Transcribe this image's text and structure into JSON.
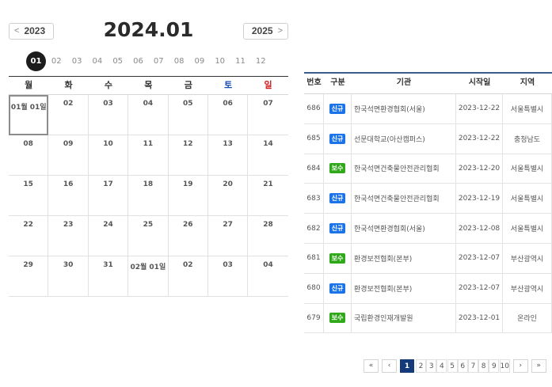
{
  "calendar": {
    "prev_year": "2023",
    "next_year": "2025",
    "title": "2024.01",
    "months": [
      "01",
      "02",
      "03",
      "04",
      "05",
      "06",
      "07",
      "08",
      "09",
      "10",
      "11",
      "12"
    ],
    "active_month_index": 0,
    "weekdays": [
      "월",
      "화",
      "수",
      "목",
      "금",
      "토",
      "일"
    ],
    "days": [
      "01월 01일",
      "02",
      "03",
      "04",
      "05",
      "06",
      "07",
      "08",
      "09",
      "10",
      "11",
      "12",
      "13",
      "14",
      "15",
      "16",
      "17",
      "18",
      "19",
      "20",
      "21",
      "22",
      "23",
      "24",
      "25",
      "26",
      "27",
      "28",
      "29",
      "30",
      "31",
      "02월 01일",
      "02",
      "03",
      "04"
    ],
    "colors": {
      "saturday": "#1b4fb5",
      "sunday": "#d0191c",
      "active_month_bg": "#1d1d1d"
    }
  },
  "table": {
    "headers": [
      "번호",
      "구분",
      "기관",
      "시작일",
      "지역"
    ],
    "rows": [
      {
        "no": "686",
        "type": "신규",
        "type_kind": "new",
        "org": "한국석면환경협회(서울)",
        "date": "2023-12-22",
        "region": "서울특별시"
      },
      {
        "no": "685",
        "type": "신규",
        "type_kind": "new",
        "org": "선문대학교(아산캠퍼스)",
        "date": "2023-12-22",
        "region": "충청남도"
      },
      {
        "no": "684",
        "type": "보수",
        "type_kind": "sup",
        "org": "한국석면건축물안전관리협회",
        "date": "2023-12-20",
        "region": "서울특별시"
      },
      {
        "no": "683",
        "type": "신규",
        "type_kind": "new",
        "org": "한국석면건축물안전관리협회",
        "date": "2023-12-19",
        "region": "서울특별시"
      },
      {
        "no": "682",
        "type": "신규",
        "type_kind": "new",
        "org": "한국석면환경협회(서울)",
        "date": "2023-12-08",
        "region": "서울특별시"
      },
      {
        "no": "681",
        "type": "보수",
        "type_kind": "sup",
        "org": "환경보전협회(본부)",
        "date": "2023-12-07",
        "region": "부산광역시"
      },
      {
        "no": "680",
        "type": "신규",
        "type_kind": "new",
        "org": "환경보전협회(본부)",
        "date": "2023-12-07",
        "region": "부산광역시"
      },
      {
        "no": "679",
        "type": "보수",
        "type_kind": "sup",
        "org": "국립환경인재개발원",
        "date": "2023-12-01",
        "region": "온라인"
      }
    ],
    "colors": {
      "new_badge": "#1a73e8",
      "sup_badge": "#2fa81a",
      "header_border": "#3a5d8c"
    }
  },
  "pagination": {
    "first": "«",
    "prev": "‹",
    "pages": [
      "1",
      "2",
      "3",
      "4",
      "5",
      "6",
      "7",
      "8",
      "9",
      "10"
    ],
    "active_page": "1",
    "next": "›",
    "last": "»",
    "active_color": "#153a7a"
  }
}
